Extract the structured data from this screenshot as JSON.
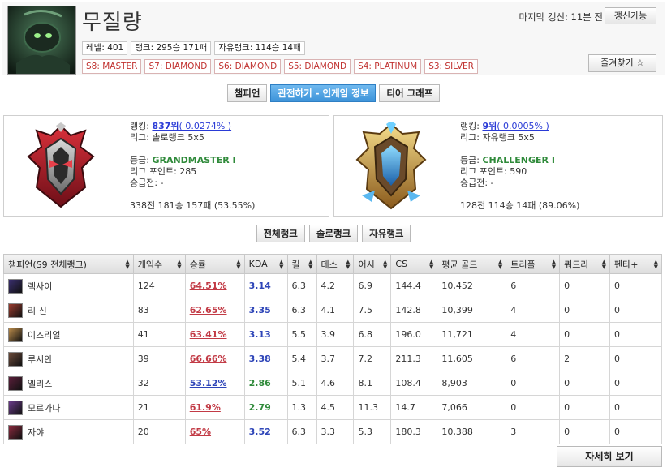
{
  "profile": {
    "name": "무질량",
    "level": "레벨: 401",
    "rank_record": "랭크: 295승 171패",
    "flex_record": "자유랭크: 114승 14패",
    "seasons": [
      "S8: MASTER",
      "S7: DIAMOND",
      "S6: DIAMOND",
      "S5: DIAMOND",
      "S4: PLATINUM",
      "S3: SILVER"
    ],
    "last_update": "마지막 갱신: 11분 전",
    "update_button": "갱신가능",
    "favorite_button": "즐겨찾기 ☆"
  },
  "tabs": [
    {
      "label": "챔피언",
      "active": false
    },
    {
      "label": "관전하기 - 인게임 정보",
      "active": true
    },
    {
      "label": "티어 그래프",
      "active": false
    }
  ],
  "solo_rank": {
    "ranking_label": "랭킹: ",
    "ranking": "837위",
    "ranking_pct": "( 0.0274% )",
    "league": "리그: 솔로랭크 5x5",
    "tier_label": "등급: ",
    "tier": "GRANDMASTER I",
    "league_points": "리그 포인트: 285",
    "promo": "승급전: -",
    "record": "338전 181승 157패 (53.55%)"
  },
  "flex_rank": {
    "ranking_label": "랭킹: ",
    "ranking": "9위",
    "ranking_pct": "( 0.0005% )",
    "league": "리그: 자유랭크 5x5",
    "tier_label": "등급: ",
    "tier": "CHALLENGER I",
    "league_points": "리그 포인트: 590",
    "promo": "승급전: -",
    "record": "128전 114승 14패 (89.06%)"
  },
  "queue_buttons": [
    "전체랭크",
    "솔로랭크",
    "자유랭크"
  ],
  "table": {
    "headers": [
      "챔피언(S9 전체랭크)",
      "게임수",
      "승률",
      "KDA",
      "킬",
      "데스",
      "어시",
      "CS",
      "평균 골드",
      "트리플",
      "쿼드라",
      "펜타+"
    ],
    "rows": [
      {
        "champion": "렉사이",
        "games": "124",
        "winrate": "64.51%",
        "wr_color": "red",
        "kda": "3.14",
        "kda_color": "blue",
        "kills": "6.3",
        "deaths": "4.2",
        "assists": "6.9",
        "cs": "144.4",
        "gold": "10,452",
        "triple": "6",
        "quadra": "0",
        "penta": "0",
        "portrait_color": "#3a2f6e"
      },
      {
        "champion": "리 신",
        "games": "83",
        "winrate": "62.65%",
        "wr_color": "red",
        "kda": "3.35",
        "kda_color": "blue",
        "kills": "6.3",
        "deaths": "4.1",
        "assists": "7.5",
        "cs": "142.8",
        "gold": "10,399",
        "triple": "4",
        "quadra": "0",
        "penta": "0",
        "portrait_color": "#9a3b2e"
      },
      {
        "champion": "이즈리얼",
        "games": "41",
        "winrate": "63.41%",
        "wr_color": "red",
        "kda": "3.13",
        "kda_color": "blue",
        "kills": "5.5",
        "deaths": "3.9",
        "assists": "6.8",
        "cs": "196.0",
        "gold": "11,721",
        "triple": "4",
        "quadra": "0",
        "penta": "0",
        "portrait_color": "#b88a4a"
      },
      {
        "champion": "루시안",
        "games": "39",
        "winrate": "66.66%",
        "wr_color": "red",
        "kda": "3.38",
        "kda_color": "blue",
        "kills": "5.4",
        "deaths": "3.7",
        "assists": "7.2",
        "cs": "211.3",
        "gold": "11,605",
        "triple": "6",
        "quadra": "2",
        "penta": "0",
        "portrait_color": "#6b4a3a"
      },
      {
        "champion": "엘리스",
        "games": "32",
        "winrate": "53.12%",
        "wr_color": "blue",
        "kda": "2.86",
        "kda_color": "green",
        "kills": "5.1",
        "deaths": "4.6",
        "assists": "8.1",
        "cs": "108.4",
        "gold": "8,903",
        "triple": "0",
        "quadra": "0",
        "penta": "0",
        "portrait_color": "#5a1f3a"
      },
      {
        "champion": "모르가나",
        "games": "21",
        "winrate": "61.9%",
        "wr_color": "red",
        "kda": "2.79",
        "kda_color": "green",
        "kills": "1.3",
        "deaths": "4.5",
        "assists": "11.3",
        "cs": "14.7",
        "gold": "7,066",
        "triple": "0",
        "quadra": "0",
        "penta": "0",
        "portrait_color": "#6a3a8a"
      },
      {
        "champion": "자야",
        "games": "20",
        "winrate": "65%",
        "wr_color": "red",
        "kda": "3.52",
        "kda_color": "blue",
        "kills": "6.3",
        "deaths": "3.3",
        "assists": "5.3",
        "cs": "180.3",
        "gold": "10,388",
        "triple": "3",
        "quadra": "0",
        "penta": "0",
        "portrait_color": "#8a2a3e"
      }
    ]
  },
  "more_button": "자세히 보기"
}
